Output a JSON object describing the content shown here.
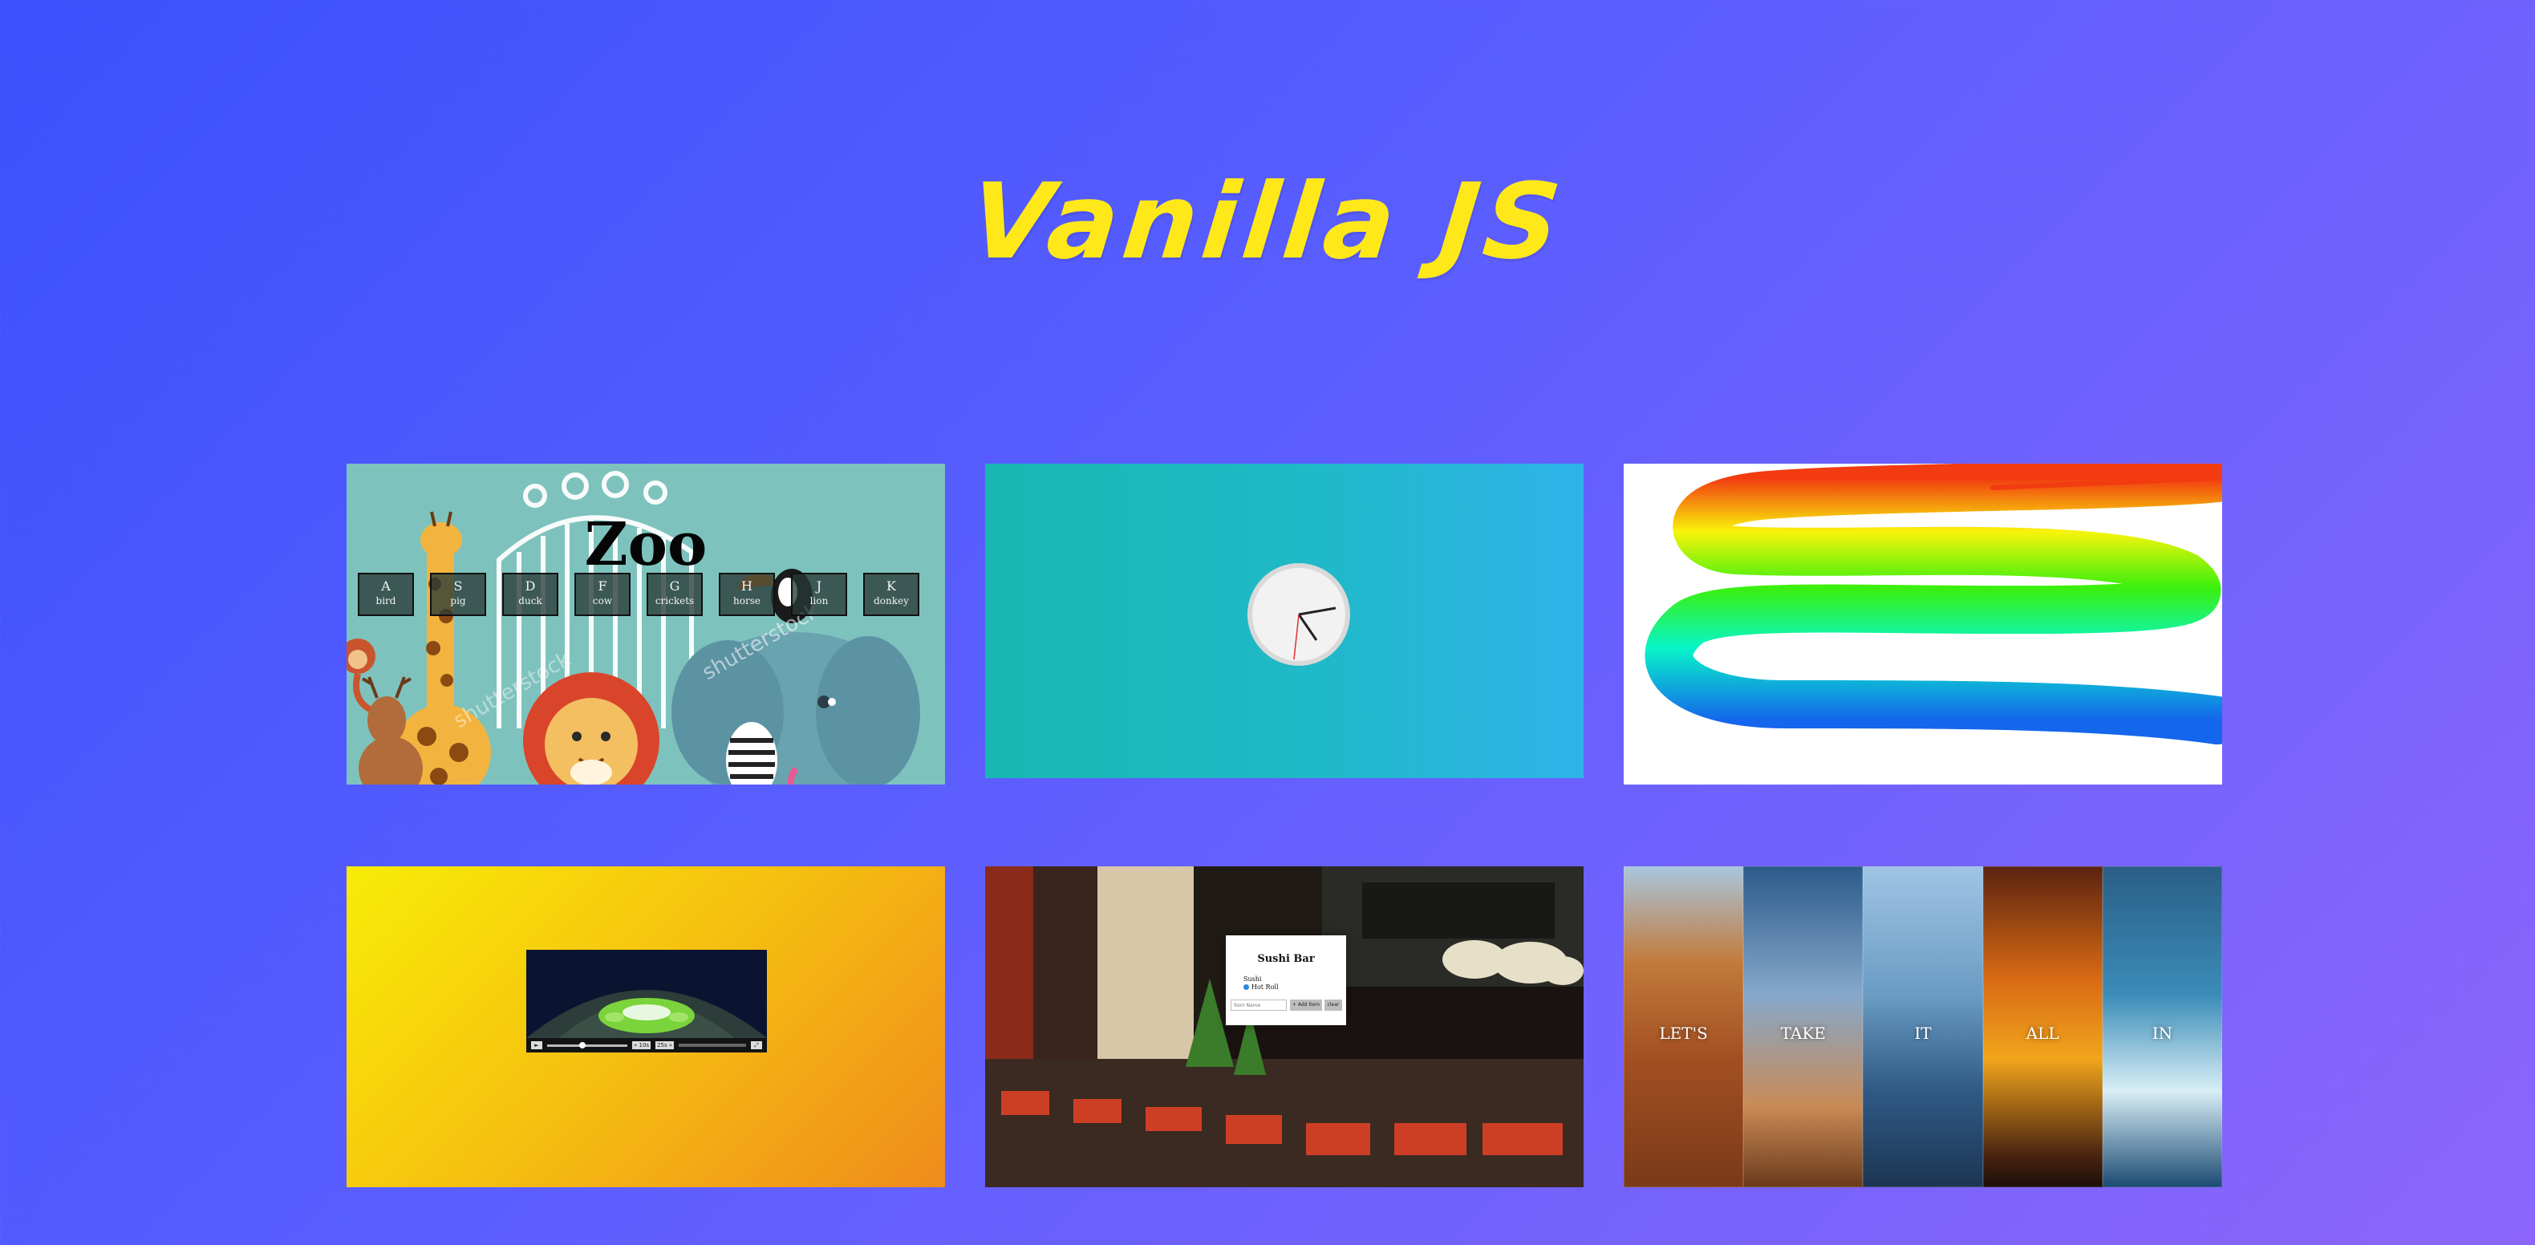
{
  "page": {
    "title": "Vanilla JS",
    "colors": {
      "background_start": "#3a51fd",
      "background_end": "#8c66fc",
      "title": "#ffe81a"
    }
  },
  "cards": {
    "zoo": {
      "title": "Zoo",
      "keys": [
        {
          "key": "A",
          "sound": "bird"
        },
        {
          "key": "S",
          "sound": "pig"
        },
        {
          "key": "D",
          "sound": "duck"
        },
        {
          "key": "F",
          "sound": "cow"
        },
        {
          "key": "G",
          "sound": "crickets"
        },
        {
          "key": "H",
          "sound": "horse"
        },
        {
          "key": "J",
          "sound": "lion"
        },
        {
          "key": "K",
          "sound": "donkey"
        }
      ]
    },
    "clock": {
      "icon": "clock-icon"
    },
    "paint": {
      "icon": "rainbow-stroke"
    },
    "video": {
      "icon": "video-player-icon",
      "speed": "1x",
      "skip_back": "« 10s",
      "skip_forward": "25s »"
    },
    "sushi": {
      "title": "Sushi Bar",
      "items": [
        "Sushi",
        "Hot Roll"
      ],
      "input_placeholder": "Item Name",
      "add_button": "+ Add Item",
      "clear_button": "clear"
    },
    "panels": {
      "words": [
        "LET'S",
        "TAKE",
        "IT",
        "ALL",
        "IN"
      ]
    }
  }
}
